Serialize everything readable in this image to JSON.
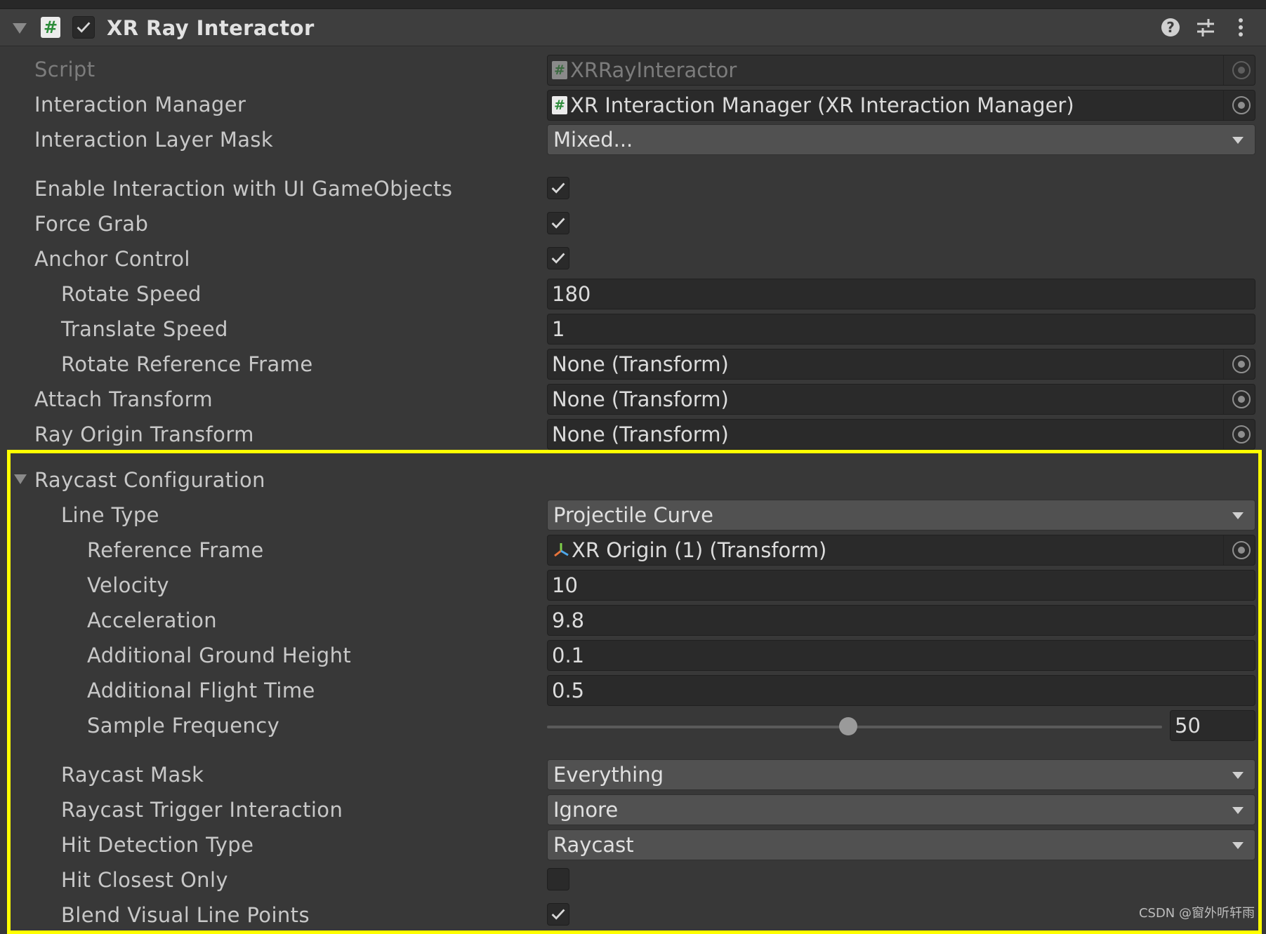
{
  "component": {
    "title": "XR Ray Interactor",
    "icons": [
      "collapse-triangle",
      "script-icon",
      "checkmark-icon",
      "help-icon",
      "preset-icon",
      "more-icon"
    ]
  },
  "fields": {
    "script": {
      "label": "Script",
      "value": "XRRayInteractor"
    },
    "interaction_manager": {
      "label": "Interaction Manager",
      "value": "XR Interaction Manager (XR Interaction Manager)"
    },
    "interaction_layer_mask": {
      "label": "Interaction Layer Mask",
      "value": "Mixed..."
    },
    "enable_ui": {
      "label": "Enable Interaction with UI GameObjects",
      "checked": true
    },
    "force_grab": {
      "label": "Force Grab",
      "checked": true
    },
    "anchor_control": {
      "label": "Anchor Control",
      "checked": true
    },
    "rotate_speed": {
      "label": "Rotate Speed",
      "value": "180"
    },
    "translate_speed": {
      "label": "Translate Speed",
      "value": "1"
    },
    "rotate_reference_frame": {
      "label": "Rotate Reference Frame",
      "value": "None (Transform)"
    },
    "attach_transform": {
      "label": "Attach Transform",
      "value": "None (Transform)"
    },
    "ray_origin_transform": {
      "label": "Ray Origin Transform",
      "value": "None (Transform)"
    }
  },
  "raycast": {
    "section_label": "Raycast Configuration",
    "line_type": {
      "label": "Line Type",
      "value": "Projectile Curve"
    },
    "reference_frame": {
      "label": "Reference Frame",
      "value": "XR Origin (1) (Transform)"
    },
    "velocity": {
      "label": "Velocity",
      "value": "10"
    },
    "acceleration": {
      "label": "Acceleration",
      "value": "9.8"
    },
    "additional_ground_height": {
      "label": "Additional Ground Height",
      "value": "0.1"
    },
    "additional_flight_time": {
      "label": "Additional Flight Time",
      "value": "0.5"
    },
    "sample_frequency": {
      "label": "Sample Frequency",
      "value": "50",
      "slider_fraction": 0.49
    },
    "raycast_mask": {
      "label": "Raycast Mask",
      "value": "Everything"
    },
    "raycast_trigger_interaction": {
      "label": "Raycast Trigger Interaction",
      "value": "Ignore"
    },
    "hit_detection_type": {
      "label": "Hit Detection Type",
      "value": "Raycast"
    },
    "hit_closest_only": {
      "label": "Hit Closest Only",
      "checked": false
    },
    "blend_visual_line_points": {
      "label": "Blend Visual Line Points",
      "checked": true
    }
  },
  "colors": {
    "panel_bg": "#383838",
    "highlight": "#ffff00",
    "script_icon_green": "#2c8c3a"
  },
  "watermark": "CSDN @窗外听轩雨"
}
